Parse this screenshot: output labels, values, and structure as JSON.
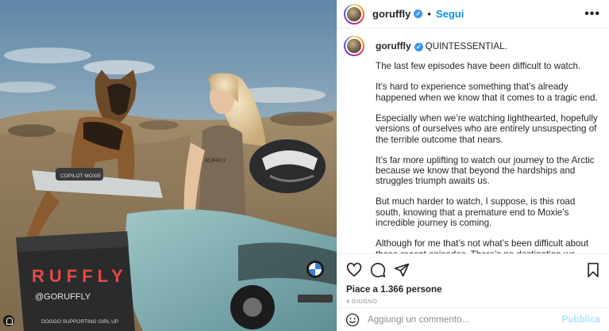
{
  "post": {
    "username": "goruffly",
    "follow_label": "Segui",
    "separator": "•",
    "more_icon": "ellipsis-icon",
    "caption_title": "QUINTESSENTIAL.",
    "caption_paragraphs": [
      "The last few episodes have been difficult to watch.",
      "It’s hard to experience something that’s already happened when we know that it comes to a tragic end.",
      "Especially when we’re watching lighthearted, hopefully versions of ourselves who are entirely unsuspecting of the terrible outcome that nears.",
      "It’s far more uplifting to watch our journey to the Arctic because we know that beyond the hardships and struggles triumph awaits us.",
      "But much harder to watch, I suppose, is this road south, knowing that a premature end to Moxie’s incredible journey is coming.",
      "Although for me that’s not what’s been difficult about these recent episodes. There’s no destination we could reach or fail"
    ],
    "likes_text": "Piace a 1.366 persone",
    "date_text": "4 GIUGNO",
    "comment": {
      "placeholder": "Aggiungi un commento...",
      "publish_label": "Pubblica"
    }
  },
  "photo": {
    "pannier_brand": "RUFFLY",
    "pannier_handle": "@GORUFFLY",
    "pannier_tagline": "DOGGO SUPPORTING GIRL UP",
    "bag_label": "COPILOT MOXIE",
    "shirt_text": "RUFFLY"
  },
  "colors": {
    "link_blue": "#0095f6",
    "verified_blue": "#3897f0",
    "publish_disabled": "#b2dffc",
    "text": "#262626",
    "muted": "#8e8e8e",
    "divider": "#efefef"
  }
}
